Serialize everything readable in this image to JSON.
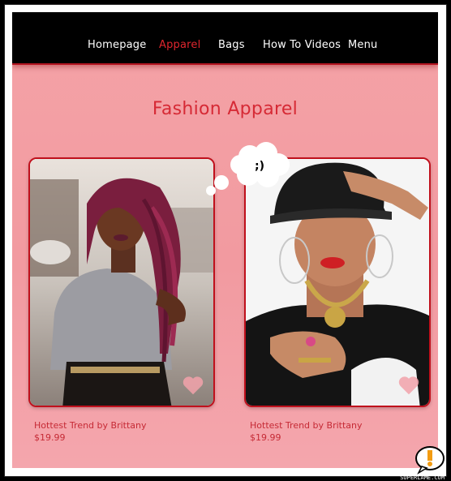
{
  "nav": {
    "items": [
      {
        "label": "Homepage",
        "active": false
      },
      {
        "label": "Apparel",
        "active": true
      },
      {
        "label": "Bags",
        "active": false
      },
      {
        "label": "How To Videos",
        "active": false
      },
      {
        "label": "Menu",
        "active": false
      }
    ]
  },
  "page": {
    "title": "Fashion Apparel"
  },
  "bubble": {
    "text": ";)"
  },
  "products": [
    {
      "caption": "Hottest Trend by Brittany",
      "price": "$19.99",
      "photo": "woman-with-magenta-braids"
    },
    {
      "caption": "Hottest Trend by Brittany",
      "price": "$19.99",
      "photo": "woman-in-black-cap-with-gold-jewelry"
    }
  ],
  "watermark": {
    "text": "SUPERLAME.COM"
  },
  "colors": {
    "accent": "#e0262e",
    "title": "#d62a35",
    "background": "#f4a3a7",
    "nav": "#000000",
    "card_border": "#c0101c"
  }
}
